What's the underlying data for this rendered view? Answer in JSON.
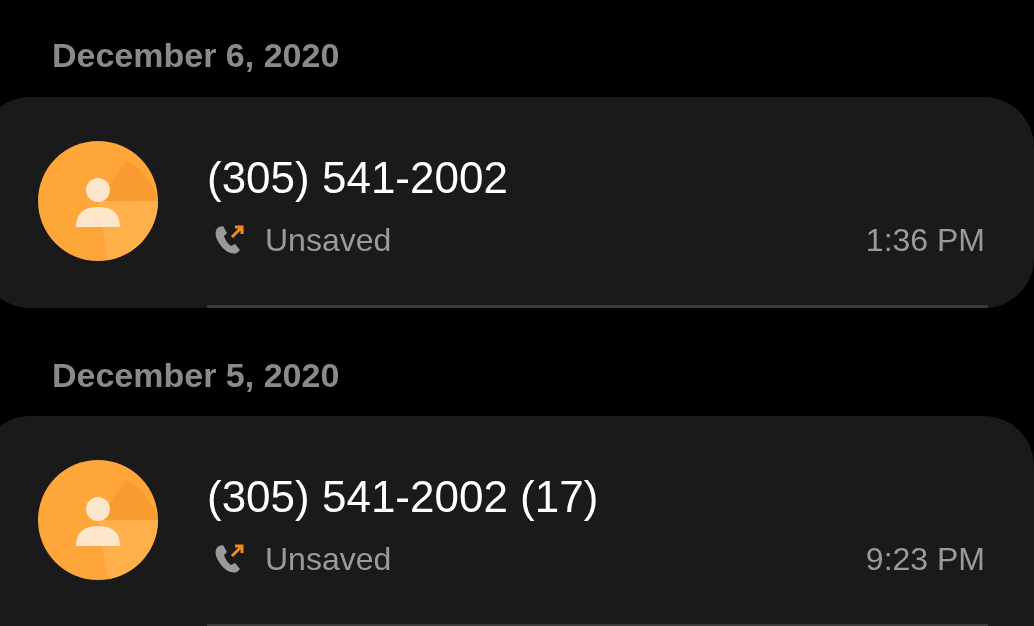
{
  "groups": [
    {
      "date": "December 6, 2020",
      "calls": [
        {
          "number": "(305) 541-2002",
          "kind": "outgoing",
          "label": "Unsaved",
          "time": "1:36 PM"
        }
      ]
    },
    {
      "date": "December 5, 2020",
      "calls": [
        {
          "number": "(305) 541-2002 (17)",
          "kind": "outgoing",
          "label": "Unsaved",
          "time": "9:23 PM"
        }
      ]
    }
  ]
}
